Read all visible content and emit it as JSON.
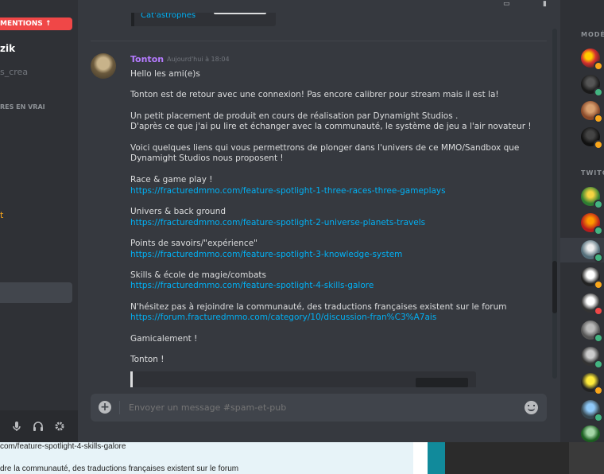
{
  "sidebar": {
    "mentions_label": "MENTIONS ↑",
    "server_name": "zik",
    "sub_label": "s_crea",
    "category_label": "RES EN VRAI",
    "channel_fragment": "t"
  },
  "embed_top": {
    "link": "Cat'astrophes"
  },
  "message": {
    "author": "Tonton",
    "timestamp": "Aujourd'hui à 18:04",
    "lines": [
      "Hello les ami(e)s",
      "Tonton est de retour avec une connexion! Pas encore calibrer pour stream mais il est la!",
      "Un petit placement de produit en cours de réalisation par Dynamight Studios .",
      "D'après ce que j'ai pu lire et échanger avec la communauté, le système de jeu a l'air novateur !",
      "Voici quelques liens qui vous permettrons de plonger dans l'univers de ce MMO/Sandbox que",
      " Dynamight Studios nous proposent !",
      "Race & game play !",
      "https://fracturedmmo.com/feature-spotlight-1-three-races-three-gameplays",
      "Univers & back ground",
      "https://fracturedmmo.com/feature-spotlight-2-universe-planets-travels",
      "Points de savoirs/\"expérience\"",
      "https://fracturedmmo.com/feature-spotlight-3-knowledge-system",
      "Skills & école de magie/combats",
      "https://fracturedmmo.com/feature-spotlight-4-skills-galore",
      "N'hésitez pas à rejoindre la communauté, des traductions françaises existent sur le forum",
      "https://forum.fracturedmmo.com/category/10/discussion-fran%C3%A7ais",
      "Gamicalement !",
      "Tonton !"
    ]
  },
  "input": {
    "placeholder": "Envoyer un message #spam-et-pub"
  },
  "members": {
    "category_1": "MODÉ",
    "category_2": "TWITC"
  },
  "background_page": {
    "line_1": "com/feature-spotlight-4-skills-galore",
    "line_2": "dre la communauté, des traductions françaises existent sur le forum"
  },
  "colors": {
    "accent_link": "#00b0f4",
    "author": "#b57bff",
    "mention_pill": "#f04747",
    "status_online": "#43b581",
    "status_idle": "#faa61a",
    "status_dnd": "#f04747"
  }
}
